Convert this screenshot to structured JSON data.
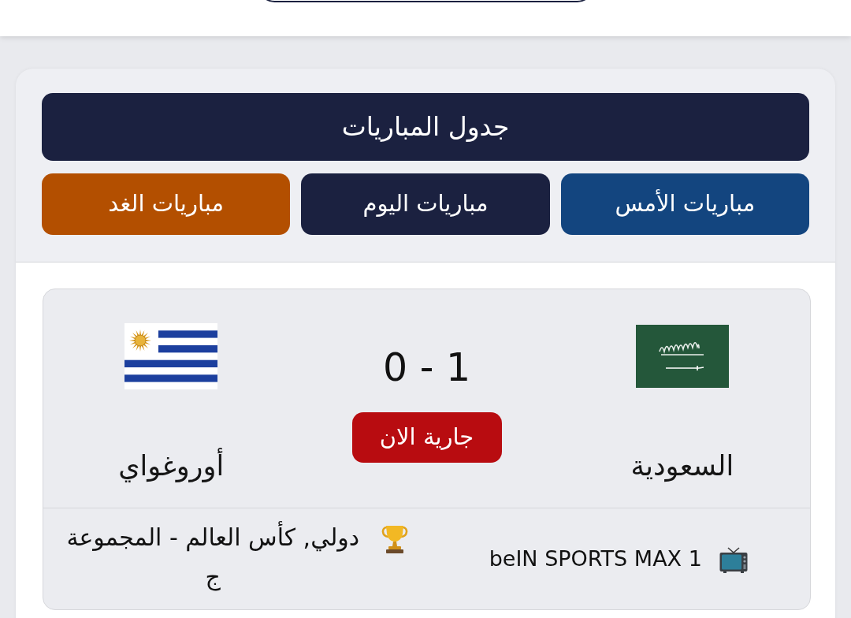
{
  "schedule": {
    "title": "جدول المباريات",
    "tabs": [
      {
        "label": "مباريات الأمس",
        "color": "#13457f"
      },
      {
        "label": "مباريات اليوم",
        "color": "#1b2140"
      },
      {
        "label": "مباريات الغد",
        "color": "#b34f00"
      }
    ]
  },
  "matches": [
    {
      "teams": [
        {
          "name": "السعودية",
          "kind": "saudi"
        },
        {
          "name": "أوروغواي",
          "kind": "uruguay"
        }
      ],
      "score": "0 - 1",
      "status": {
        "label": "جارية الان"
      },
      "channel": "beIN SPORTS MAX 1",
      "competition": "دولي, كأس العالم - المجموعة ج"
    }
  ]
}
